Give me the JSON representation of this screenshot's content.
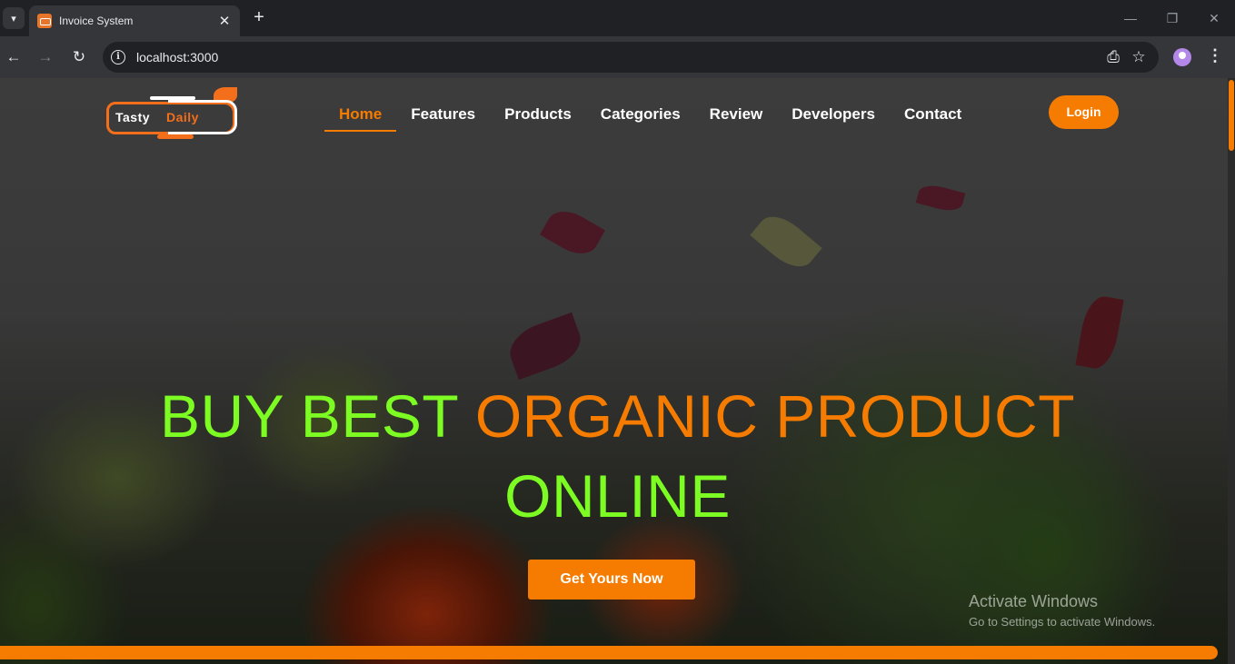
{
  "browser": {
    "tab_title": "Invoice System",
    "url": "localhost:3000",
    "tab_close": "✕",
    "new_tab": "+",
    "minimize": "—",
    "restore": "❐",
    "close": "✕"
  },
  "nav": {
    "back": "←",
    "forward": "→",
    "reload": "↻",
    "install_icon": "⎙",
    "star_icon": "☆",
    "menu_icon": "⋮",
    "info_icon": "i"
  },
  "site": {
    "logo": {
      "word1": "Tasty",
      "word2": "Daily"
    },
    "menu": [
      {
        "label": "Home",
        "active": true
      },
      {
        "label": "Features"
      },
      {
        "label": "Products"
      },
      {
        "label": "Categories"
      },
      {
        "label": "Review"
      },
      {
        "label": "Developers"
      },
      {
        "label": "Contact"
      }
    ],
    "login_label": "Login",
    "hero": {
      "headline_green": "BUY BEST",
      "headline_orange": "ORGANIC PRODUCT",
      "headline_line2": "ONLINE",
      "cta_label": "Get Yours Now"
    }
  },
  "watermark": {
    "title": "Activate Windows",
    "subtitle": "Go to Settings to activate Windows."
  },
  "colors": {
    "accent": "#f57c00",
    "headline_green": "#7cfc22"
  }
}
